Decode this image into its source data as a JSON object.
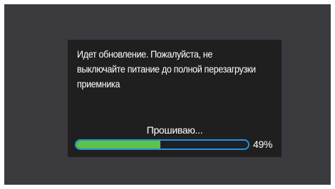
{
  "dialog": {
    "message_lines": [
      "Идет обновление. Пожалуйста, не",
      "выключайте питание до полной перезагрузки",
      "приемника"
    ],
    "status": "Прошиваю...",
    "progress": {
      "value": 0.49,
      "percent_label": "49%"
    }
  },
  "colors": {
    "screen_background": "#3a3a3f",
    "dialog_background": "#1f1f1f",
    "progress_border": "#2d8fd3",
    "progress_fill": "#5cc24a",
    "text": "#ffffff"
  }
}
